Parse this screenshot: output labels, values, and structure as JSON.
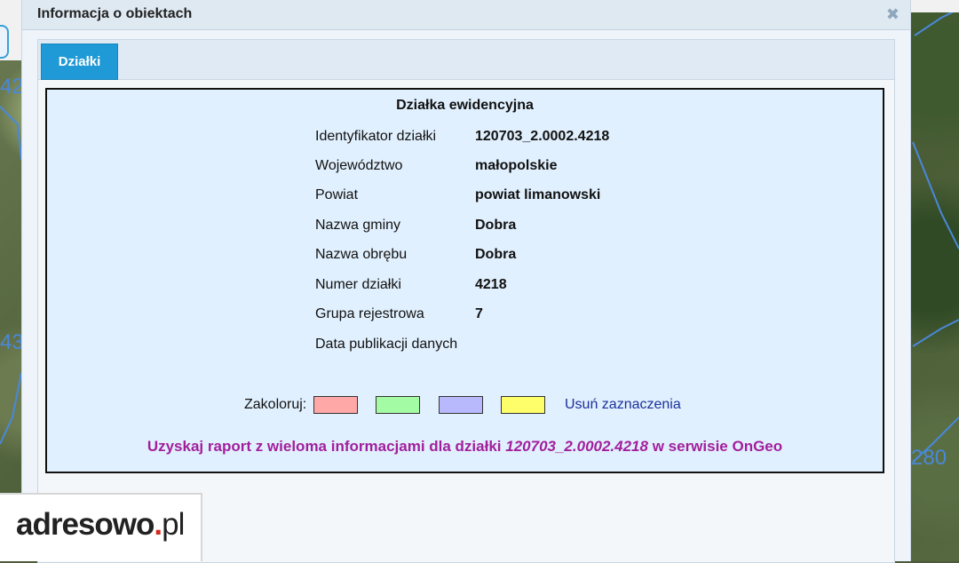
{
  "map": {
    "labels": [
      "42",
      "43",
      "280"
    ]
  },
  "dialog": {
    "title": "Informacja o obiektach",
    "close_icon": "close-icon",
    "tab_label": "Działki"
  },
  "panel": {
    "title": "Działka ewidencyjna",
    "rows": [
      {
        "label": "Identyfikator działki",
        "value": "120703_2.0002.4218"
      },
      {
        "label": "Województwo",
        "value": "małopolskie"
      },
      {
        "label": "Powiat",
        "value": "powiat limanowski"
      },
      {
        "label": "Nazwa gminy",
        "value": "Dobra"
      },
      {
        "label": "Nazwa obrębu",
        "value": "Dobra"
      },
      {
        "label": "Numer działki",
        "value": "4218"
      },
      {
        "label": "Grupa rejestrowa",
        "value": "7"
      },
      {
        "label": "Data publikacji danych",
        "value": ""
      }
    ],
    "colorize_label": "Zakoloruj:",
    "swatches": [
      {
        "name": "red",
        "color": "#ffa8a8"
      },
      {
        "name": "green",
        "color": "#a3fca3"
      },
      {
        "name": "blue",
        "color": "#b8b8fc"
      },
      {
        "name": "yellow",
        "color": "#fefe6a"
      }
    ],
    "clear_label": "Usuń zaznaczenia",
    "report": {
      "before": "Uzyskaj raport z wieloma informacjami dla działki ",
      "parcel": "120703_2.0002.4218",
      "after": " w serwisie OnGeo"
    }
  },
  "logo": {
    "text_main": "adresowo",
    "text_dot": ".",
    "text_tld": "pl"
  },
  "colors": {
    "tab_active": "#1f9ad6",
    "panel_bg": "#e1f0fe",
    "report_link": "#a21f9c",
    "clear_link": "#1a2f9c"
  }
}
